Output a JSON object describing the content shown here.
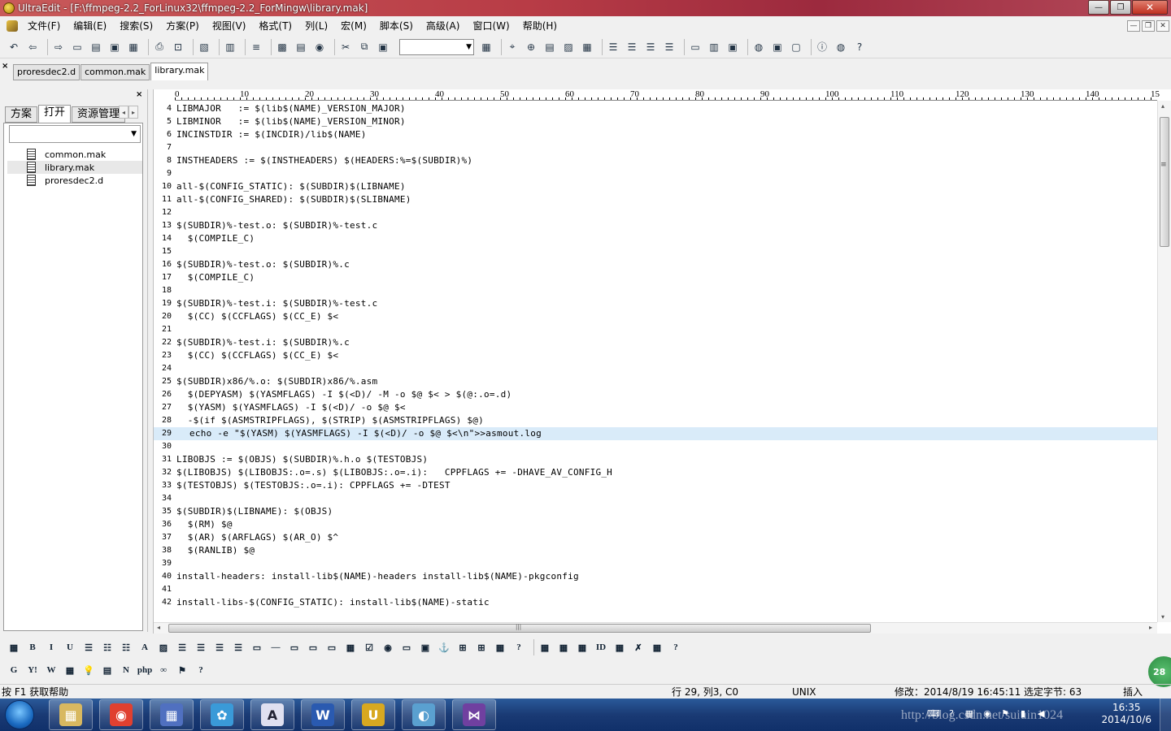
{
  "window": {
    "title": "UltraEdit - [F:\\ffmpeg-2.2_ForLinux32\\ffmpeg-2.2_ForMingw\\library.mak]",
    "buttons": [
      "—",
      "❐",
      "✕"
    ]
  },
  "menubar": {
    "items": [
      "文件(F)",
      "编辑(E)",
      "搜索(S)",
      "方案(P)",
      "视图(V)",
      "格式(T)",
      "列(L)",
      "宏(M)",
      "脚本(S)",
      "高级(A)",
      "窗口(W)",
      "帮助(H)"
    ]
  },
  "toolbar": {
    "icons": [
      "↶",
      "⇦",
      "⇨",
      "▭",
      "▤",
      "▣",
      "▦",
      "⎙",
      "⊡",
      "▧",
      "▥",
      "≡",
      "▩",
      "▤",
      "◉",
      "✂",
      "⧉",
      "▣",
      "▦",
      "⌖",
      "⊕",
      "▤",
      "▨",
      "▦",
      "☰",
      "☰",
      "☰",
      "☰",
      "▭",
      "▥",
      "▣",
      "◍",
      "▣",
      "▢",
      "ⓘ",
      "◍"
    ],
    "help": "?"
  },
  "file_tabs": {
    "close": "×",
    "tabs": [
      "proresdec2.d",
      "common.mak",
      "library.mak"
    ],
    "active": 2
  },
  "left_panel": {
    "close": "×",
    "tabs": [
      "方案",
      "打开",
      "资源管理"
    ],
    "active_tab": 1,
    "arrows": [
      "◂",
      "▸"
    ],
    "files": [
      "common.mak",
      "library.mak",
      "proresdec2.d"
    ],
    "selected_file": 1
  },
  "ruler": {
    "labels": [
      "0",
      "10",
      "20",
      "30",
      "40",
      "50",
      "60",
      "70",
      "80",
      "90",
      "100",
      "110",
      "120",
      "130",
      "140",
      "15"
    ]
  },
  "code": {
    "lines": [
      {
        "n": "4",
        "text": "LIBMAJOR   := $(lib$(NAME)_VERSION_MAJOR)"
      },
      {
        "n": "5",
        "text": "LIBMINOR   := $(lib$(NAME)_VERSION_MINOR)"
      },
      {
        "n": "6",
        "text": "INCINSTDIR := $(INCDIR)/lib$(NAME)"
      },
      {
        "n": "7",
        "text": ""
      },
      {
        "n": "8",
        "text": "INSTHEADERS := $(INSTHEADERS) $(HEADERS:%=$(SUBDIR)%)"
      },
      {
        "n": "9",
        "text": ""
      },
      {
        "n": "10",
        "text": "all-$(CONFIG_STATIC): $(SUBDIR)$(LIBNAME)"
      },
      {
        "n": "11",
        "text": "all-$(CONFIG_SHARED): $(SUBDIR)$(SLIBNAME)"
      },
      {
        "n": "12",
        "text": ""
      },
      {
        "n": "13",
        "text": "$(SUBDIR)%-test.o: $(SUBDIR)%-test.c"
      },
      {
        "n": "14",
        "text": "  $(COMPILE_C)"
      },
      {
        "n": "15",
        "text": ""
      },
      {
        "n": "16",
        "text": "$(SUBDIR)%-test.o: $(SUBDIR)%.c"
      },
      {
        "n": "17",
        "text": "  $(COMPILE_C)"
      },
      {
        "n": "18",
        "text": ""
      },
      {
        "n": "19",
        "text": "$(SUBDIR)%-test.i: $(SUBDIR)%-test.c"
      },
      {
        "n": "20",
        "text": "  $(CC) $(CCFLAGS) $(CC_E) $<"
      },
      {
        "n": "21",
        "text": ""
      },
      {
        "n": "22",
        "text": "$(SUBDIR)%-test.i: $(SUBDIR)%.c"
      },
      {
        "n": "23",
        "text": "  $(CC) $(CCFLAGS) $(CC_E) $<"
      },
      {
        "n": "24",
        "text": ""
      },
      {
        "n": "25",
        "text": "$(SUBDIR)x86/%.o: $(SUBDIR)x86/%.asm"
      },
      {
        "n": "26",
        "text": "  $(DEPYASM) $(YASMFLAGS) -I $(<D)/ -M -o $@ $< > $(@:.o=.d)"
      },
      {
        "n": "27",
        "text": "  $(YASM) $(YASMFLAGS) -I $(<D)/ -o $@ $<"
      },
      {
        "n": "28",
        "text": "  -$(if $(ASMSTRIPFLAGS), $(STRIP) $(ASMSTRIPFLAGS) $@)"
      },
      {
        "n": "29",
        "text": "echo -e \"$(YASM) $(YASMFLAGS) -I $(<D)/ -o $@ $<\\n\">>asmout.log"
      },
      {
        "n": "30",
        "text": ""
      },
      {
        "n": "31",
        "text": "LIBOBJS := $(OBJS) $(SUBDIR)%.h.o $(TESTOBJS)"
      },
      {
        "n": "32",
        "text": "$(LIBOBJS) $(LIBOBJS:.o=.s) $(LIBOBJS:.o=.i):   CPPFLAGS += -DHAVE_AV_CONFIG_H"
      },
      {
        "n": "33",
        "text": "$(TESTOBJS) $(TESTOBJS:.o=.i): CPPFLAGS += -DTEST"
      },
      {
        "n": "34",
        "text": ""
      },
      {
        "n": "35",
        "text": "$(SUBDIR)$(LIBNAME): $(OBJS)"
      },
      {
        "n": "36",
        "text": "  $(RM) $@"
      },
      {
        "n": "37",
        "text": "  $(AR) $(ARFLAGS) $(AR_O) $^"
      },
      {
        "n": "38",
        "text": "  $(RANLIB) $@"
      },
      {
        "n": "39",
        "text": ""
      },
      {
        "n": "40",
        "text": "install-headers: install-lib$(NAME)-headers install-lib$(NAME)-pkgconfig"
      },
      {
        "n": "41",
        "text": ""
      },
      {
        "n": "42",
        "text": "install-libs-$(CONFIG_STATIC): install-lib$(NAME)-static"
      }
    ],
    "selected_line": 25
  },
  "scroll": {
    "up": "▴",
    "down": "▾",
    "left": "◂",
    "right": "▸",
    "grip": "≡",
    "hgrip": "|||"
  },
  "bottom_toolbar1": {
    "icons": [
      "▦",
      "B",
      "I",
      "U",
      "☰",
      "☷",
      "☷",
      "A",
      "▨",
      "☰",
      "☰",
      "☰",
      "☰",
      "▭",
      "—",
      "▭",
      "▭",
      "▭",
      "▦",
      "☑",
      "◉",
      "▭",
      "▣",
      "⚓",
      "⊞",
      "⊞",
      "▦",
      "?",
      "▦",
      "▦",
      "▦",
      "ID",
      "▦",
      "✗",
      "▦",
      "?"
    ]
  },
  "bottom_toolbar2": {
    "icons": [
      "G",
      "Y!",
      "W",
      "▦",
      "💡",
      "▤",
      "N",
      "php",
      "∞",
      "⚑",
      "?"
    ]
  },
  "statusbar": {
    "help": "按 F1 获取帮助",
    "position": "行 29, 列3, C0",
    "line_ending": "UNIX",
    "modified": "修改：2014/8/19 16:45:11  选定字节: 63",
    "mode": "插入"
  },
  "taskbar": {
    "apps": [
      "explorer",
      "chrome",
      "network",
      "qq",
      "notepad",
      "word",
      "ultraedit",
      "paint",
      "visual-studio"
    ],
    "clock_time": "16:35",
    "clock_date": "2014/10/6",
    "watermark": "http://blog.csdn.net/suiuin1024"
  },
  "side_badge": "28",
  "colors": {
    "selection": "#d9ebf9",
    "titlebar": "#b83c46",
    "taskbar": "#1a3a74"
  }
}
